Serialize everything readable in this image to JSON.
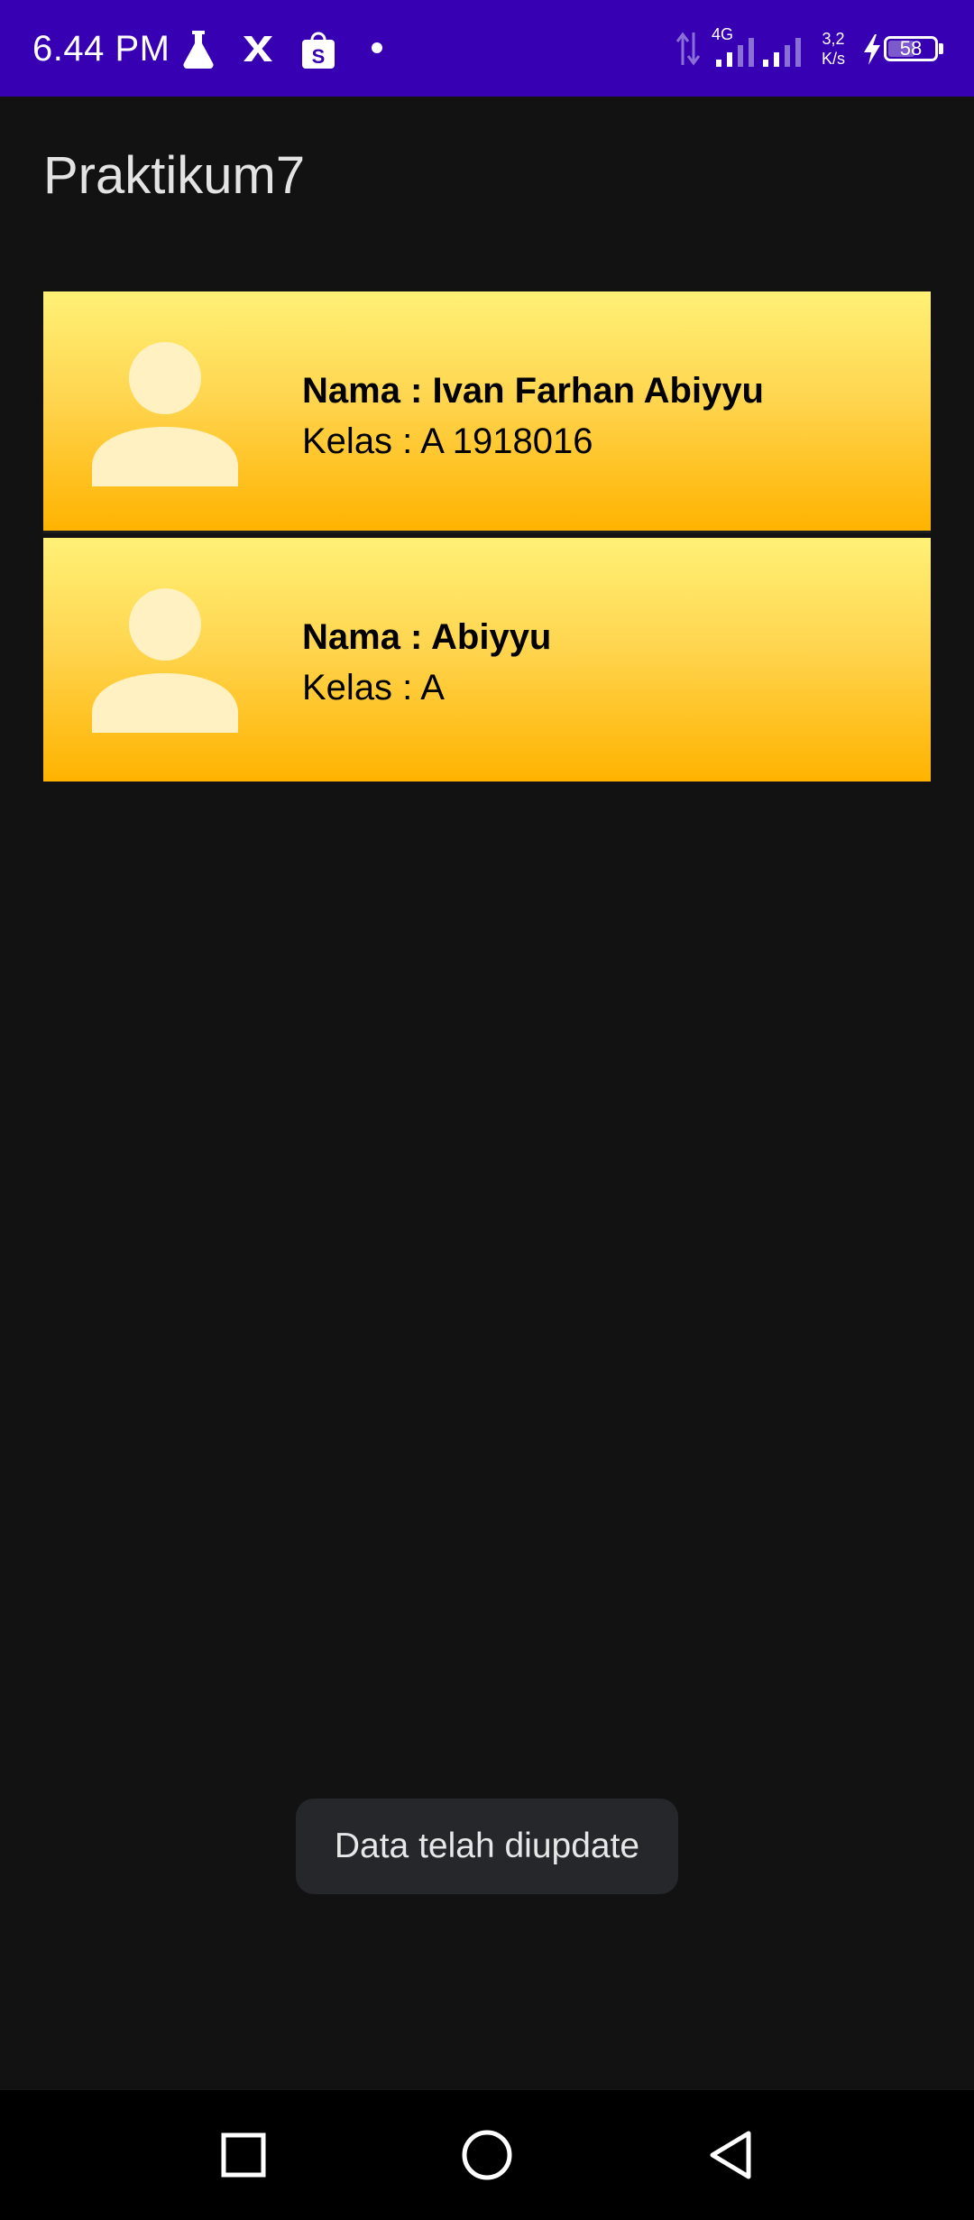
{
  "status_bar": {
    "time": "6.44 PM",
    "network_type": "4G",
    "net_speed_value": "3,2",
    "net_speed_unit": "K/s",
    "battery_level": "58",
    "battery_fraction": 0.58,
    "icons": [
      "lab-flask-icon",
      "x-icon",
      "shopping-bag-icon",
      "dot-icon",
      "data-arrows-icon",
      "signal-4g-icon",
      "signal-icon",
      "charging-bolt-icon",
      "battery-icon"
    ],
    "background_color": "#3700b3"
  },
  "app_bar": {
    "title": "Praktikum7"
  },
  "students": [
    {
      "name": "Nama : Ivan Farhan Abiyyu",
      "kelas": "Kelas : A 1918016"
    },
    {
      "name": "Nama : Abiyyu",
      "kelas": "Kelas : A"
    }
  ],
  "card_colors": {
    "gradient_top": "#fff176",
    "gradient_bottom": "#ffb300",
    "avatar_color": "#fff1c1"
  },
  "toast": {
    "message": "Data telah diupdate"
  },
  "nav_bar": {
    "buttons": [
      "recents-square-icon",
      "home-circle-icon",
      "back-triangle-icon"
    ]
  }
}
